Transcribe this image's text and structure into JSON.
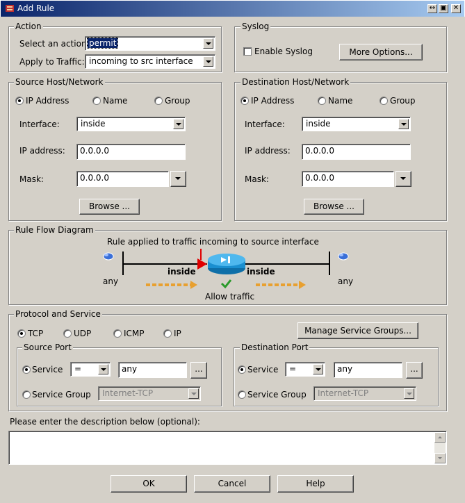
{
  "window": {
    "title": "Add Rule"
  },
  "action": {
    "group_label": "Action",
    "select_label": "Select an action:",
    "select_value": "permit",
    "apply_label": "Apply to Traffic:",
    "apply_value": "incoming to src interface"
  },
  "syslog": {
    "group_label": "Syslog",
    "enable_label": "Enable Syslog",
    "more_options": "More Options..."
  },
  "source": {
    "group_label": "Source Host/Network",
    "radio_ip": "IP Address",
    "radio_name": "Name",
    "radio_group": "Group",
    "interface_label": "Interface:",
    "interface_value": "inside",
    "ip_label": "IP address:",
    "ip_value": "0.0.0.0",
    "mask_label": "Mask:",
    "mask_value": "0.0.0.0",
    "browse": "Browse ..."
  },
  "destination": {
    "group_label": "Destination Host/Network",
    "radio_ip": "IP Address",
    "radio_name": "Name",
    "radio_group": "Group",
    "interface_label": "Interface:",
    "interface_value": "inside",
    "ip_label": "IP address:",
    "ip_value": "0.0.0.0",
    "mask_label": "Mask:",
    "mask_value": "0.0.0.0",
    "browse": "Browse ..."
  },
  "diagram": {
    "group_label": "Rule Flow Diagram",
    "caption": "Rule applied to traffic incoming to source interface",
    "left_interface": "inside",
    "right_interface": "inside",
    "left_any": "any",
    "right_any": "any",
    "result": "Allow traffic"
  },
  "protocol": {
    "group_label": "Protocol and Service",
    "tcp": "TCP",
    "udp": "UDP",
    "icmp": "ICMP",
    "ip": "IP",
    "manage": "Manage Service Groups..."
  },
  "source_port": {
    "group_label": "Source Port",
    "service_label": "Service",
    "operator": "=",
    "value": "any",
    "ellipsis": "...",
    "service_group_label": "Service Group",
    "service_group_value": "Internet-TCP"
  },
  "dest_port": {
    "group_label": "Destination Port",
    "service_label": "Service",
    "operator": "=",
    "value": "any",
    "ellipsis": "...",
    "service_group_label": "Service Group",
    "service_group_value": "Internet-TCP"
  },
  "description": {
    "label": "Please enter the description below (optional):",
    "value": ""
  },
  "buttons": {
    "ok": "OK",
    "cancel": "Cancel",
    "help": "Help"
  },
  "colors": {
    "title_start": "#0a246a",
    "title_end": "#a6caf0",
    "flow_arrow": "#e8a030",
    "router": "#1a8fd0",
    "check": "#2a9a2a",
    "marker": "#e00000"
  }
}
